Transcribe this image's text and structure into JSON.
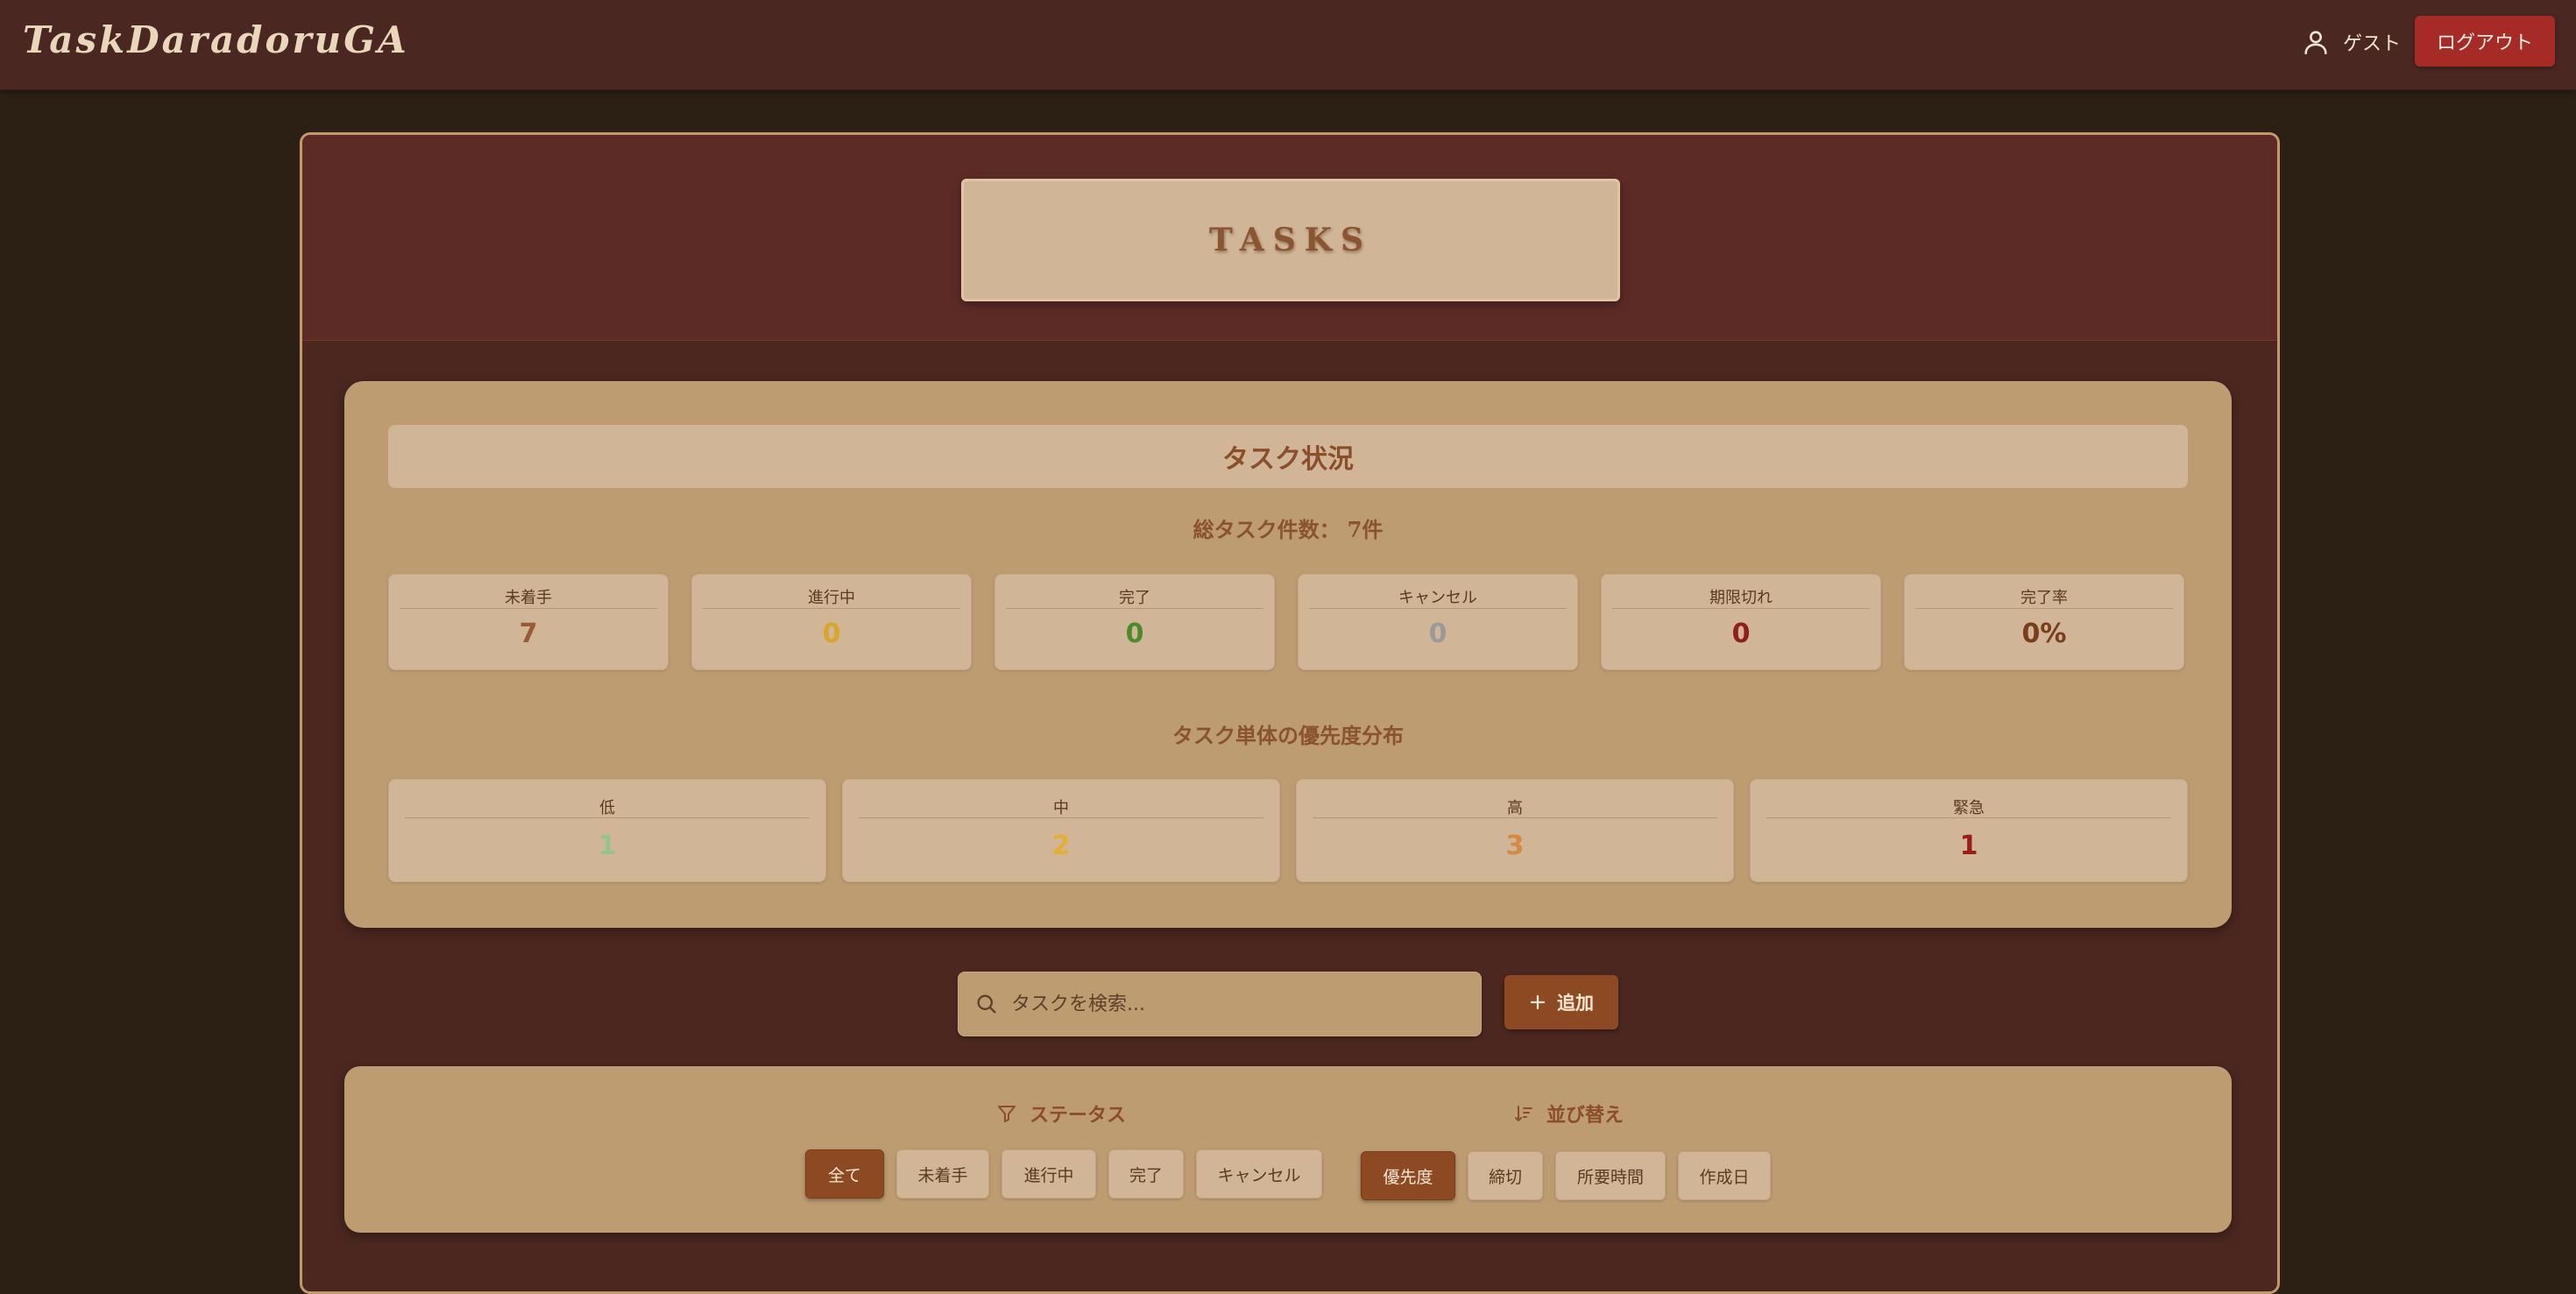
{
  "app": {
    "title": "TaskDaradoruGA"
  },
  "header": {
    "user_label": "ゲスト",
    "logout_label": "ログアウト"
  },
  "page": {
    "title": "TASKS"
  },
  "status": {
    "title": "タスク状況",
    "total_label": "総タスク件数：",
    "total_value": "7件",
    "cards": [
      {
        "label": "未着手",
        "value": "7",
        "color": "#9a5a35"
      },
      {
        "label": "進行中",
        "value": "0",
        "color": "#d9a52a"
      },
      {
        "label": "完了",
        "value": "0",
        "color": "#4d8a2a"
      },
      {
        "label": "キャンセル",
        "value": "0",
        "color": "#9a9a9a"
      },
      {
        "label": "期限切れ",
        "value": "0",
        "color": "#8e1f1b"
      },
      {
        "label": "完了率",
        "value": "0%",
        "color": "#7a3d1c"
      }
    ]
  },
  "priority": {
    "title": "タスク単体の優先度分布",
    "cards": [
      {
        "label": "低",
        "value": "1",
        "color": "#92c48d"
      },
      {
        "label": "中",
        "value": "2",
        "color": "#e3b036"
      },
      {
        "label": "高",
        "value": "3",
        "color": "#d28a44"
      },
      {
        "label": "緊急",
        "value": "1",
        "color": "#9c1c18"
      }
    ]
  },
  "search": {
    "placeholder": "タスクを検索...",
    "value": ""
  },
  "add_label": "追加",
  "filters": {
    "status_label": "ステータス",
    "status_options": [
      "全て",
      "未着手",
      "進行中",
      "完了",
      "キャンセル"
    ],
    "status_selected": "全て",
    "sort_label": "並び替え",
    "sort_options": [
      "優先度",
      "締切",
      "所要時間",
      "作成日"
    ],
    "sort_selected": "優先度"
  }
}
